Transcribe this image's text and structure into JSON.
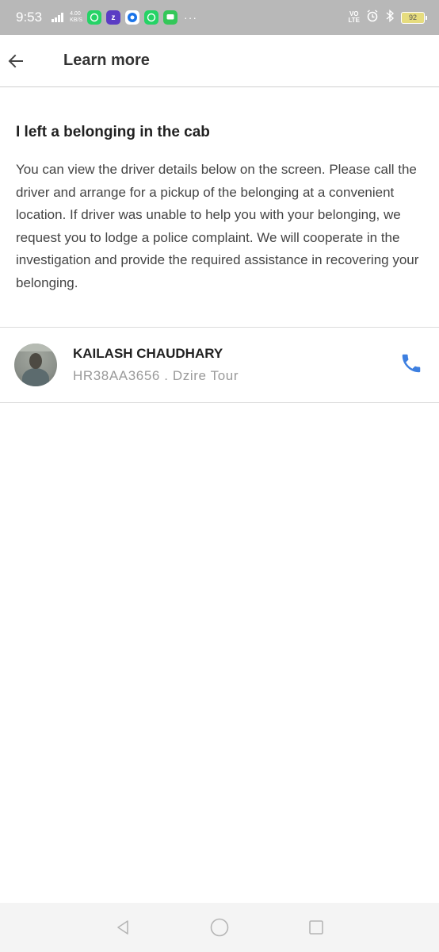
{
  "status_bar": {
    "time": "9:53",
    "net_speed_value": "4.00",
    "net_speed_unit": "KB/S",
    "network_type": "4G",
    "volte_line1": "VO",
    "volte_line2": "LTE",
    "battery_level": "92",
    "notification_icons": [
      "whatsapp-icon",
      "zomato-icon",
      "chrome-icon",
      "whatsapp-business-icon",
      "messages-icon"
    ],
    "more": "···"
  },
  "app_bar": {
    "back_icon": "arrow-left-icon",
    "title": "Learn more"
  },
  "content": {
    "heading": "I left a belonging in the cab",
    "body": "You can view the driver details below on the screen. Please call the driver and arrange for a pickup of the belonging at a convenient location. If driver was unable to help you with your belonging, we request you to lodge a police complaint. We will cooperate in the investigation and provide the required assistance in recovering your belonging."
  },
  "driver": {
    "name": "KAILASH CHAUDHARY",
    "vehicle": "HR38AA3656 . Dzire Tour",
    "call_icon": "phone-icon"
  },
  "colors": {
    "status_bar_bg": "#b8b8b8",
    "accent_blue": "#3d7fe0",
    "body_text": "#444444",
    "secondary_text": "#9a9a9a"
  },
  "nav_bar": {
    "icons": [
      "back-triangle-icon",
      "home-circle-icon",
      "recents-square-icon"
    ]
  }
}
